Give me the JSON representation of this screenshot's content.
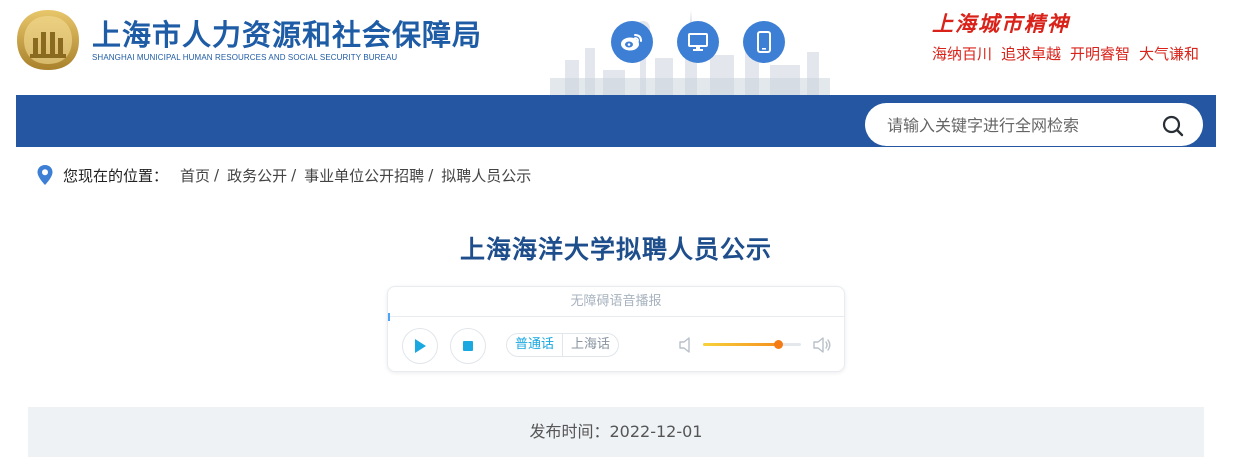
{
  "header": {
    "logo_cn": "上海市人力资源和社会保障局",
    "logo_en": "SHANGHAI MUNICIPAL HUMAN RESOURCES AND SOCIAL SECURITY BUREAU",
    "icons": [
      "weibo-icon",
      "desktop-icon",
      "mobile-icon"
    ],
    "icon_color": "#3d7fd4",
    "spirit_title": "上海城市精神",
    "spirit_words": [
      "海纳百川",
      "追求卓越",
      "开明睿智",
      "大气谦和"
    ],
    "spirit_color": "#d9231a"
  },
  "nav": {
    "bar_color": "#2456a1",
    "search_placeholder": "请输入关键字进行全网检索"
  },
  "breadcrumb": {
    "lead": "您现在的位置：",
    "items": [
      "首页",
      "政务公开",
      "事业单位公开招聘",
      "拟聘人员公示"
    ],
    "separator": "/"
  },
  "article": {
    "title": "上海海洋大学拟聘人员公示",
    "publish": "发布时间：2022-12-01"
  },
  "player": {
    "header": "无障碍语音播报",
    "dialects": [
      "普通话",
      "上海话"
    ],
    "active_dialect": "普通话",
    "volume_level": 0.77
  }
}
